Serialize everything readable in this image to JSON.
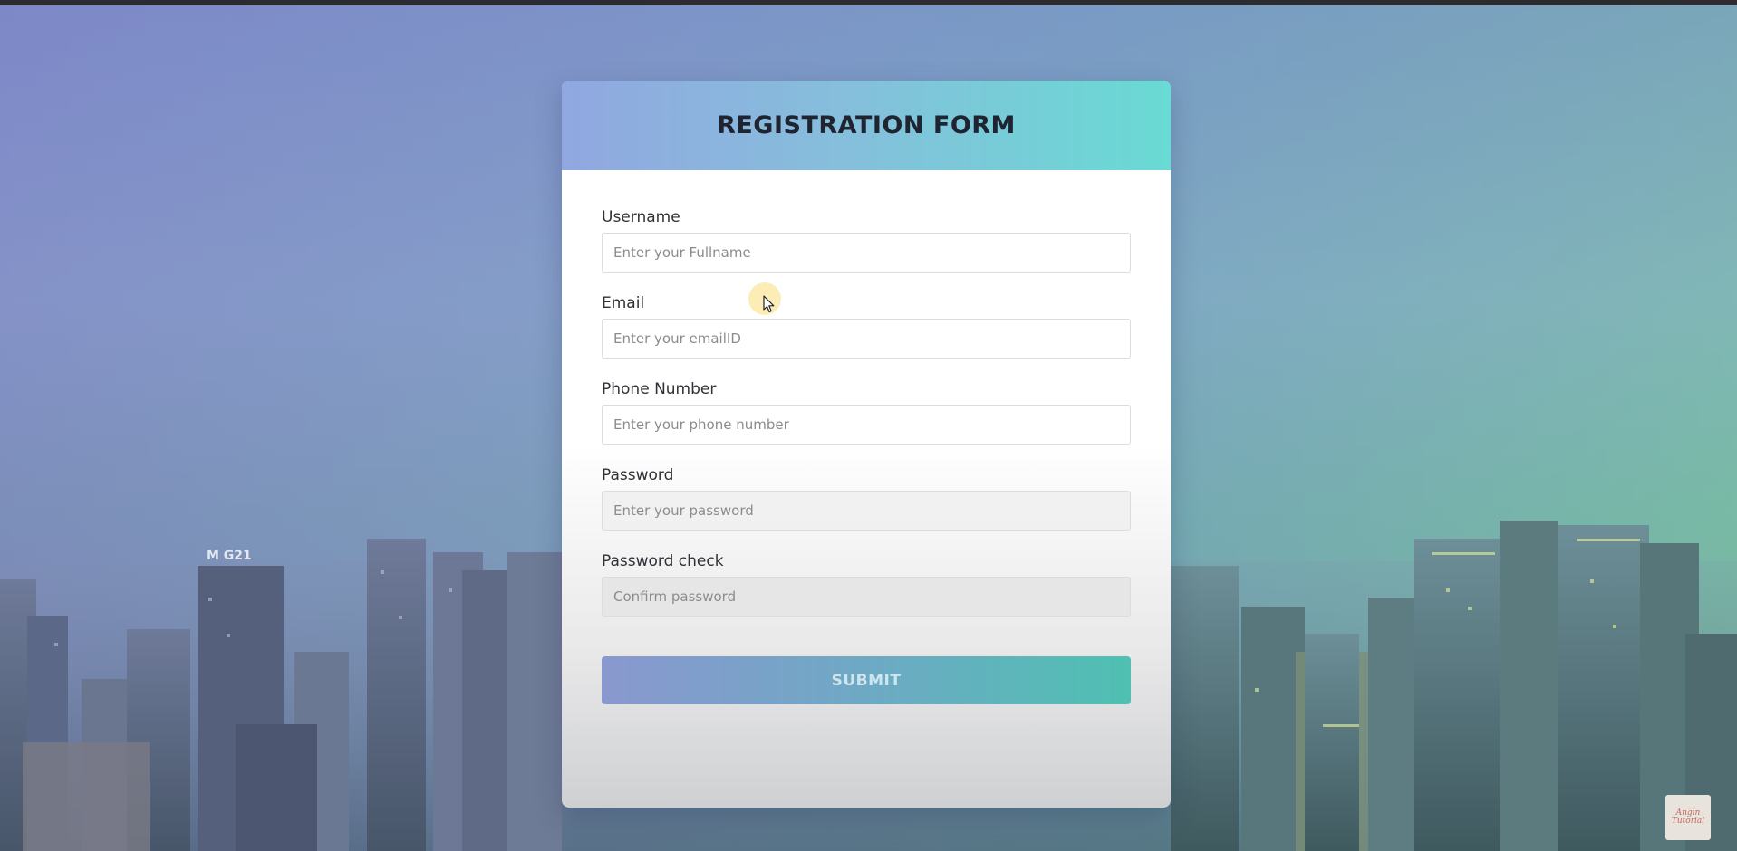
{
  "form": {
    "title": "REGISTRATION FORM",
    "fields": [
      {
        "label": "Username",
        "placeholder": "Enter your Fullname",
        "type": "text"
      },
      {
        "label": "Email",
        "placeholder": "Enter your emailID",
        "type": "email"
      },
      {
        "label": "Phone Number",
        "placeholder": "Enter your phone number",
        "type": "tel"
      },
      {
        "label": "Password",
        "placeholder": "Enter your password",
        "type": "password"
      },
      {
        "label": "Password check",
        "placeholder": "Confirm password",
        "type": "password"
      }
    ],
    "submit_label": "SUBMIT"
  },
  "background": {
    "sign_text": "M G21"
  },
  "badge": {
    "line1": "Angin",
    "line2": "Tutorial"
  },
  "colors": {
    "header_start": "#91a7e0",
    "header_end": "#69dad4",
    "button_start": "#8a98cf",
    "button_end": "#4fc0b2",
    "topbar": "#2a2c31"
  },
  "icons": {
    "cursor": "mouse-pointer-icon"
  }
}
